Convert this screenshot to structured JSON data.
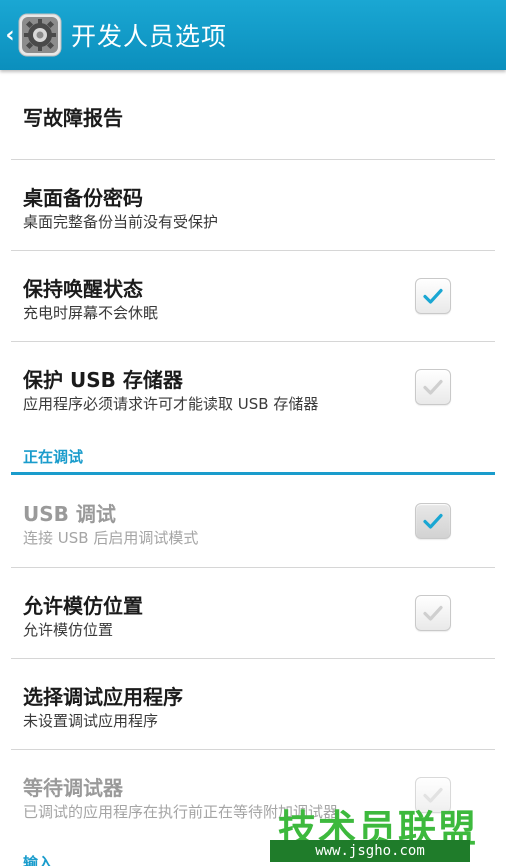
{
  "actionbar": {
    "title": "开发人员选项",
    "back_icon": "chevron-left-icon",
    "app_icon": "settings-gear-icon",
    "bg_color": "#129bc8"
  },
  "items": [
    {
      "title": "写故障报告",
      "summary": ""
    },
    {
      "title": "桌面备份密码",
      "summary": "桌面完整备份当前没有受保护"
    },
    {
      "title": "保持唤醒状态",
      "summary": "充电时屏幕不会休眠",
      "checked": true
    },
    {
      "title": "保护 USB 存储器",
      "summary": "应用程序必须请求许可才能读取 USB 存储器",
      "checked": false
    },
    {
      "title": "USB 调试",
      "summary": "连接 USB 后启用调试模式",
      "checked": true,
      "enabled": false
    },
    {
      "title": "允许模仿位置",
      "summary": "允许模仿位置",
      "checked": false
    },
    {
      "title": "选择调试应用程序",
      "summary": "未设置调试应用程序"
    },
    {
      "title": "等待调试器",
      "summary": "已调试的应用程序在执行前正在等待附加调试器",
      "checked": false,
      "enabled": false
    }
  ],
  "sections": {
    "debugging": "正在调试",
    "input": "输入"
  },
  "watermark": {
    "text": "技术员联盟",
    "url": "www.jsgho.com"
  },
  "colors": {
    "accent": "#1a9ccc",
    "check": "#1aa7d3",
    "check_disabled": "#c4c4c4"
  }
}
